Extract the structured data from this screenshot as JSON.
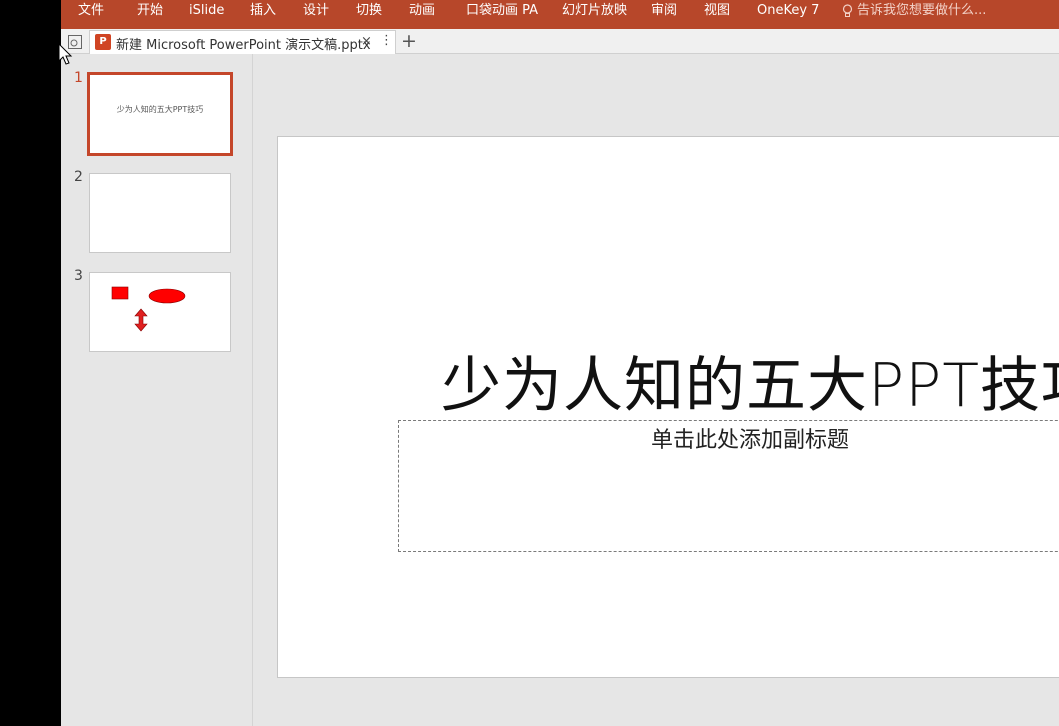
{
  "menu": {
    "items": [
      "文件",
      "开始",
      "iSlide",
      "插入",
      "设计",
      "切换",
      "动画",
      "口袋动画 PA",
      "幻灯片放映",
      "审阅",
      "视图",
      "OneKey 7"
    ],
    "tell_me": "告诉我您想要做什么..."
  },
  "tab": {
    "title": "新建 Microsoft PowerPoint 演示文稿.pptx",
    "close": "×",
    "more": "⋮",
    "new": "+"
  },
  "thumbnails": [
    {
      "number": "1",
      "text": "少为人知的五大PPT技巧"
    },
    {
      "number": "2",
      "text": ""
    },
    {
      "number": "3",
      "text": ""
    }
  ],
  "slide": {
    "title": "少为人知的五大PPT技巧",
    "subtitle": "单击此处添加副标题"
  },
  "colors": {
    "ribbon": "#b7472a",
    "accent": "#c4462a",
    "shape_red": "#ff0000"
  }
}
